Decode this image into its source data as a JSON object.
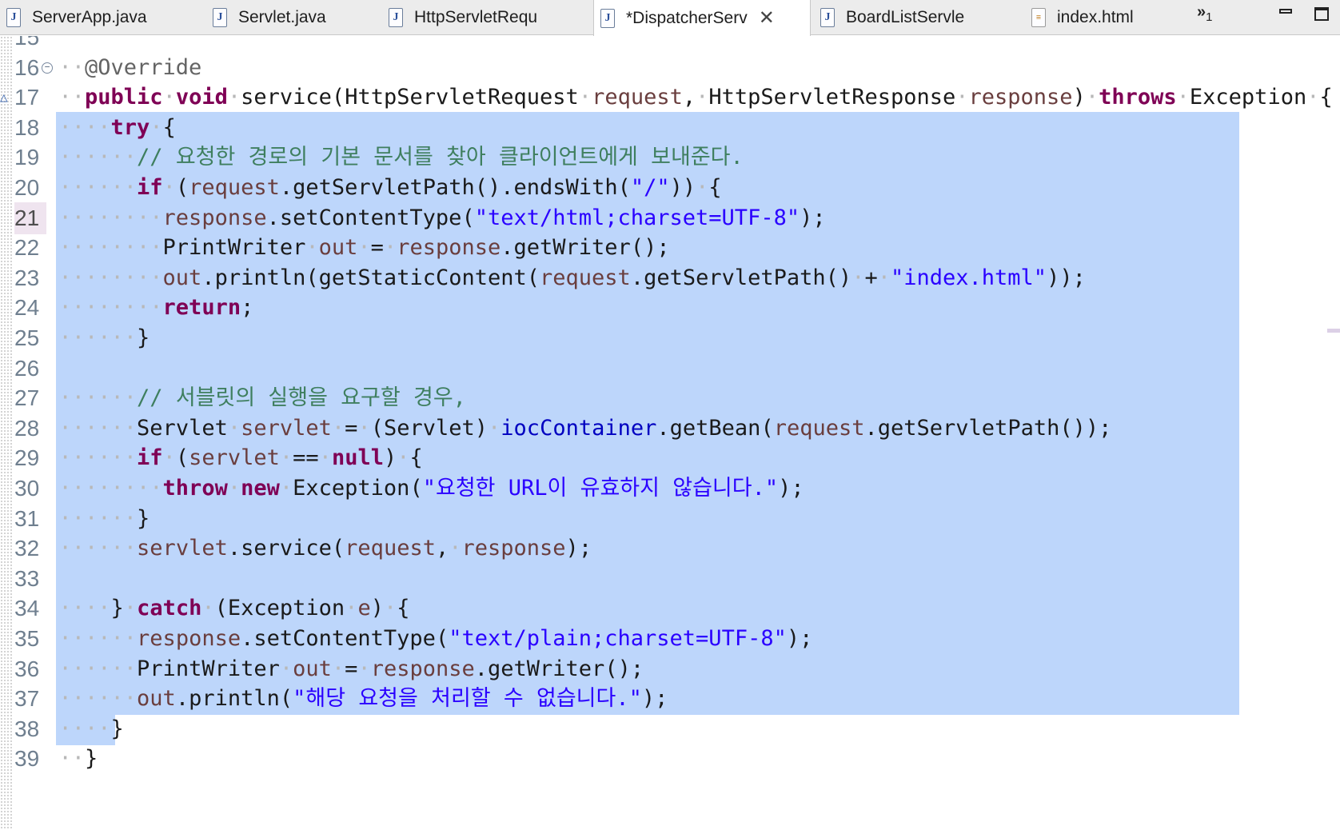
{
  "tabs": [
    {
      "label": "ServerApp.java",
      "icon": "java-file-icon",
      "active": false
    },
    {
      "label": "Servlet.java",
      "icon": "java-file-icon",
      "active": false
    },
    {
      "label": "HttpServletRequ",
      "icon": "java-file-icon",
      "active": false
    },
    {
      "label": "*DispatcherServ",
      "icon": "java-file-icon",
      "active": true
    },
    {
      "label": "BoardListServle",
      "icon": "java-file-icon",
      "active": false
    },
    {
      "label": "index.html",
      "icon": "html-file-icon",
      "active": false
    }
  ],
  "overflow_count": "1",
  "colors": {
    "keyword": "#7f0055",
    "comment": "#3f7f5f",
    "string": "#2a00ff",
    "variable": "#6a3e3e",
    "field": "#0000c0",
    "selection": "#bdd6fb"
  },
  "cursor_line": 21,
  "lines": [
    {
      "n": 15,
      "text": ""
    },
    {
      "n": 16,
      "text": "  @Override"
    },
    {
      "n": 17,
      "text": "  public void service(HttpServletRequest request, HttpServletResponse response) throws Exception {"
    },
    {
      "n": 18,
      "text": "    try {"
    },
    {
      "n": 19,
      "text": "      // 요청한 경로의 기본 문서를 찾아 클라이언트에게 보내준다."
    },
    {
      "n": 20,
      "text": "      if (request.getServletPath().endsWith(\"/\")) {"
    },
    {
      "n": 21,
      "text": "        response.setContentType(\"text/html;charset=UTF-8\");"
    },
    {
      "n": 22,
      "text": "        PrintWriter out = response.getWriter();"
    },
    {
      "n": 23,
      "text": "        out.println(getStaticContent(request.getServletPath() + \"index.html\"));"
    },
    {
      "n": 24,
      "text": "        return;"
    },
    {
      "n": 25,
      "text": "      }"
    },
    {
      "n": 26,
      "text": ""
    },
    {
      "n": 27,
      "text": "      // 서블릿의 실행을 요구할 경우,"
    },
    {
      "n": 28,
      "text": "      Servlet servlet = (Servlet) iocContainer.getBean(request.getServletPath());"
    },
    {
      "n": 29,
      "text": "      if (servlet == null) {"
    },
    {
      "n": 30,
      "text": "        throw new Exception(\"요청한 URL이 유효하지 않습니다.\");"
    },
    {
      "n": 31,
      "text": "      }"
    },
    {
      "n": 32,
      "text": "      servlet.service(request, response);"
    },
    {
      "n": 33,
      "text": ""
    },
    {
      "n": 34,
      "text": "    } catch (Exception e) {"
    },
    {
      "n": 35,
      "text": "      response.setContentType(\"text/plain;charset=UTF-8\");"
    },
    {
      "n": 36,
      "text": "      PrintWriter out = response.getWriter();"
    },
    {
      "n": 37,
      "text": "      out.println(\"해당 요청을 처리할 수 없습니다.\");"
    },
    {
      "n": 38,
      "text": "    }"
    },
    {
      "n": 39,
      "text": "  }"
    }
  ]
}
